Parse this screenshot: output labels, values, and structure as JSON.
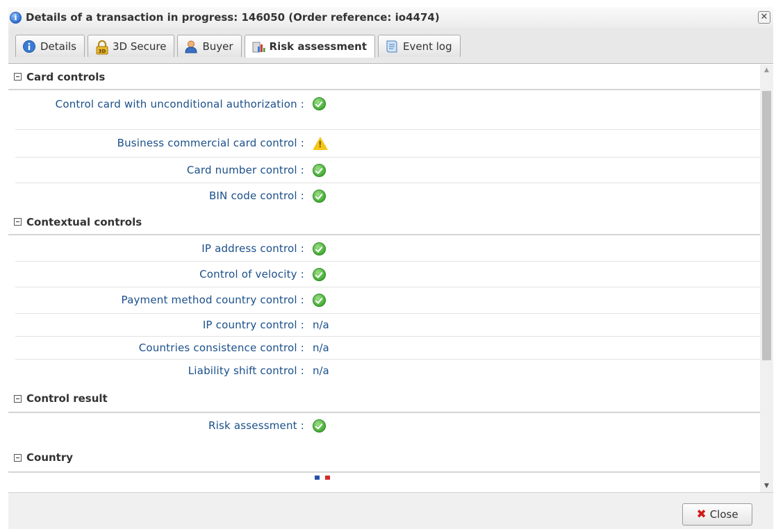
{
  "window": {
    "title": "Details of a transaction in progress: 146050 (Order reference: io4474)",
    "close_glyph": "✕"
  },
  "tabs": [
    {
      "label": "Details",
      "icon": "info-icon",
      "active": false
    },
    {
      "label": "3D Secure",
      "icon": "padlock-3d-icon",
      "active": false
    },
    {
      "label": "Buyer",
      "icon": "person-icon",
      "active": false
    },
    {
      "label": "Risk assessment",
      "icon": "chart-icon",
      "active": true
    },
    {
      "label": "Event log",
      "icon": "document-icon",
      "active": false
    }
  ],
  "sections": [
    {
      "title": "Card controls",
      "rows": [
        {
          "label": "Control card with unconditional authorization :",
          "status": "ok"
        },
        {
          "label": "Business commercial card control :",
          "status": "warning"
        },
        {
          "label": "Card number control :",
          "status": "ok"
        },
        {
          "label": "BIN code control :",
          "status": "ok"
        }
      ]
    },
    {
      "title": "Contextual controls",
      "rows": [
        {
          "label": "IP address control :",
          "status": "ok"
        },
        {
          "label": "Control of velocity :",
          "status": "ok"
        },
        {
          "label": "Payment method country control :",
          "status": "ok"
        },
        {
          "label": "IP country control :",
          "status": "text",
          "value": "n/a"
        },
        {
          "label": "Countries consistence control :",
          "status": "text",
          "value": "n/a"
        },
        {
          "label": "Liability shift control :",
          "status": "text",
          "value": "n/a"
        }
      ]
    },
    {
      "title": "Control result",
      "rows": [
        {
          "label": "Risk assessment :",
          "status": "ok"
        }
      ]
    },
    {
      "title": "Country",
      "rows": []
    }
  ],
  "footer": {
    "close_label": "Close"
  },
  "colors": {
    "label_blue": "#1a4f8a",
    "ok_green": "#3ea82e",
    "warning_yellow": "#f5c518",
    "close_red": "#d11a1a"
  }
}
